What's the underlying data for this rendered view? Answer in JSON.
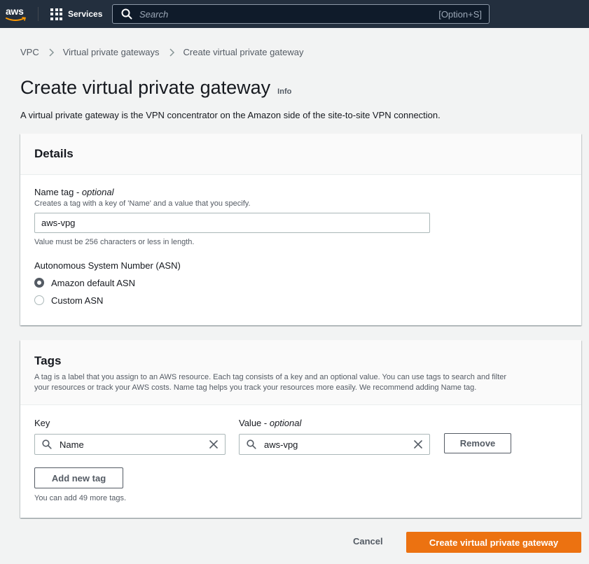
{
  "topnav": {
    "logo_text": "aws",
    "services_label": "Services",
    "search_placeholder": "Search",
    "search_shortcut": "[Option+S]"
  },
  "breadcrumb": {
    "items": [
      "VPC",
      "Virtual private gateways"
    ],
    "current": "Create virtual private gateway"
  },
  "page": {
    "title": "Create virtual private gateway",
    "info_label": "Info",
    "description": "A virtual private gateway is the VPN concentrator on the Amazon side of the site-to-site VPN connection."
  },
  "details": {
    "title": "Details",
    "name_tag_label": "Name tag - ",
    "name_tag_optional": "optional",
    "name_tag_description": "Creates a tag with a key of 'Name' and a value that you specify.",
    "name_tag_value": "aws-vpg",
    "name_tag_constraint": "Value must be 256 characters or less in length.",
    "asn_label": "Autonomous System Number (ASN)",
    "asn_options": [
      {
        "label": "Amazon default ASN",
        "selected": true
      },
      {
        "label": "Custom ASN",
        "selected": false
      }
    ]
  },
  "tags": {
    "title": "Tags",
    "description_line1": "A tag is a label that you assign to an AWS resource. Each tag consists of a key and an optional value. You can use tags to search and filter",
    "description_line2": "your resources or track your AWS costs. Name tag helps you track your resources more easily. We recommend adding Name tag.",
    "key_label": "Key",
    "value_label": "Value - ",
    "value_optional": "optional",
    "key_value": "Name",
    "value_value": "aws-vpg",
    "remove_label": "Remove",
    "add_tag_label": "Add new tag",
    "limit_text": "You can add 49 more tags."
  },
  "footer": {
    "cancel_label": "Cancel",
    "submit_label": "Create virtual private gateway"
  },
  "colors": {
    "nav_bg": "#232f3e",
    "primary": "#ec7211",
    "page_bg": "#f2f3f3"
  }
}
